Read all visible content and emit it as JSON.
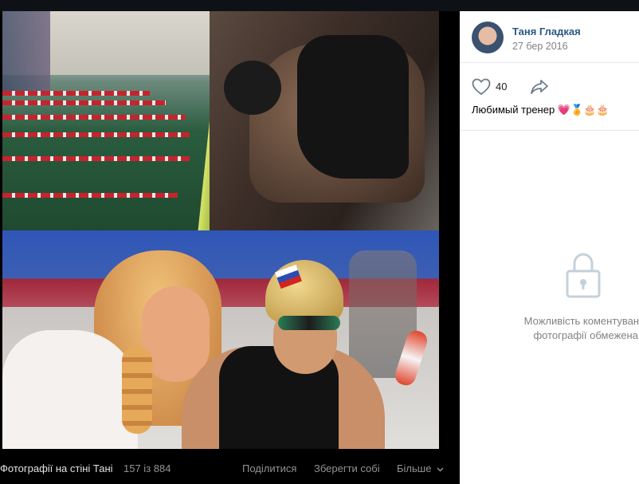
{
  "photo_viewer": {
    "album_title": "Фотографії на стіні Тані",
    "counter": "157 із 884",
    "actions": {
      "share": "Поділитися",
      "save": "Зберегти собі",
      "more": "Більше"
    }
  },
  "post": {
    "author": "Таня Гладкая",
    "date": "27 бер 2016",
    "likes": "40",
    "description": "Любимый тренер",
    "emojis": [
      "💗",
      "🏅",
      "🎂",
      "🎂"
    ]
  },
  "comments": {
    "notice_line1": "Можливість коментування",
    "notice_line2": "фотографії обмежена."
  },
  "colors": {
    "panel_bg": "#ffffff",
    "author_link": "#2a5885",
    "muted_text": "#828282",
    "viewer_bg": "#000000"
  },
  "icons": [
    "heart-icon",
    "share-arrow-icon",
    "lock-icon",
    "chevron-down-icon"
  ]
}
